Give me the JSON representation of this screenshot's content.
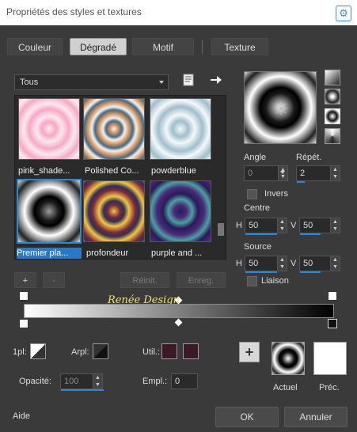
{
  "window": {
    "title": "Propriétés des styles et textures",
    "help_glyph": "⚙"
  },
  "tabs": [
    {
      "label": "Couleur"
    },
    {
      "label": "Dégradé"
    },
    {
      "label": "Motif"
    },
    {
      "label": "Texture"
    }
  ],
  "category": {
    "value": "Tous"
  },
  "gallery": {
    "items": [
      {
        "label": "pink_shade..."
      },
      {
        "label": "Polished Co..."
      },
      {
        "label": "powderblue"
      },
      {
        "label": "Premier pla..."
      },
      {
        "label": "profondeur"
      },
      {
        "label": "purple and ..."
      }
    ]
  },
  "gallery_buttons": {
    "add": "+",
    "remove": "-",
    "reset": "Réinit.",
    "save": "Enreg."
  },
  "watermark": "Renée Design",
  "angle": {
    "label": "Angle",
    "value": "0"
  },
  "repeat": {
    "label": "Répét.",
    "value": "2"
  },
  "invert": {
    "label": "Invers"
  },
  "center": {
    "label": "Centre",
    "h_label": "H",
    "h_value": "50",
    "v_label": "V",
    "v_value": "50"
  },
  "source": {
    "label": "Source",
    "h_label": "H",
    "h_value": "50",
    "v_label": "V",
    "v_value": "50"
  },
  "link": {
    "label": "Liaison"
  },
  "stops": {
    "onepl_label": "1pl:",
    "arpl_label": "Arpl:",
    "util_label": "Util.:",
    "opacity_label": "Opacité:",
    "opacity_value": "100",
    "empl_label": "Empl.:",
    "empl_value": "0"
  },
  "preview": {
    "add": "+",
    "current_label": "Actuel",
    "previous_label": "Préc."
  },
  "footer": {
    "help": "Aide",
    "ok": "OK",
    "cancel": "Annuler"
  },
  "colors": {
    "accent": "#2a88d8",
    "util_swatch": "#3a1a26"
  }
}
